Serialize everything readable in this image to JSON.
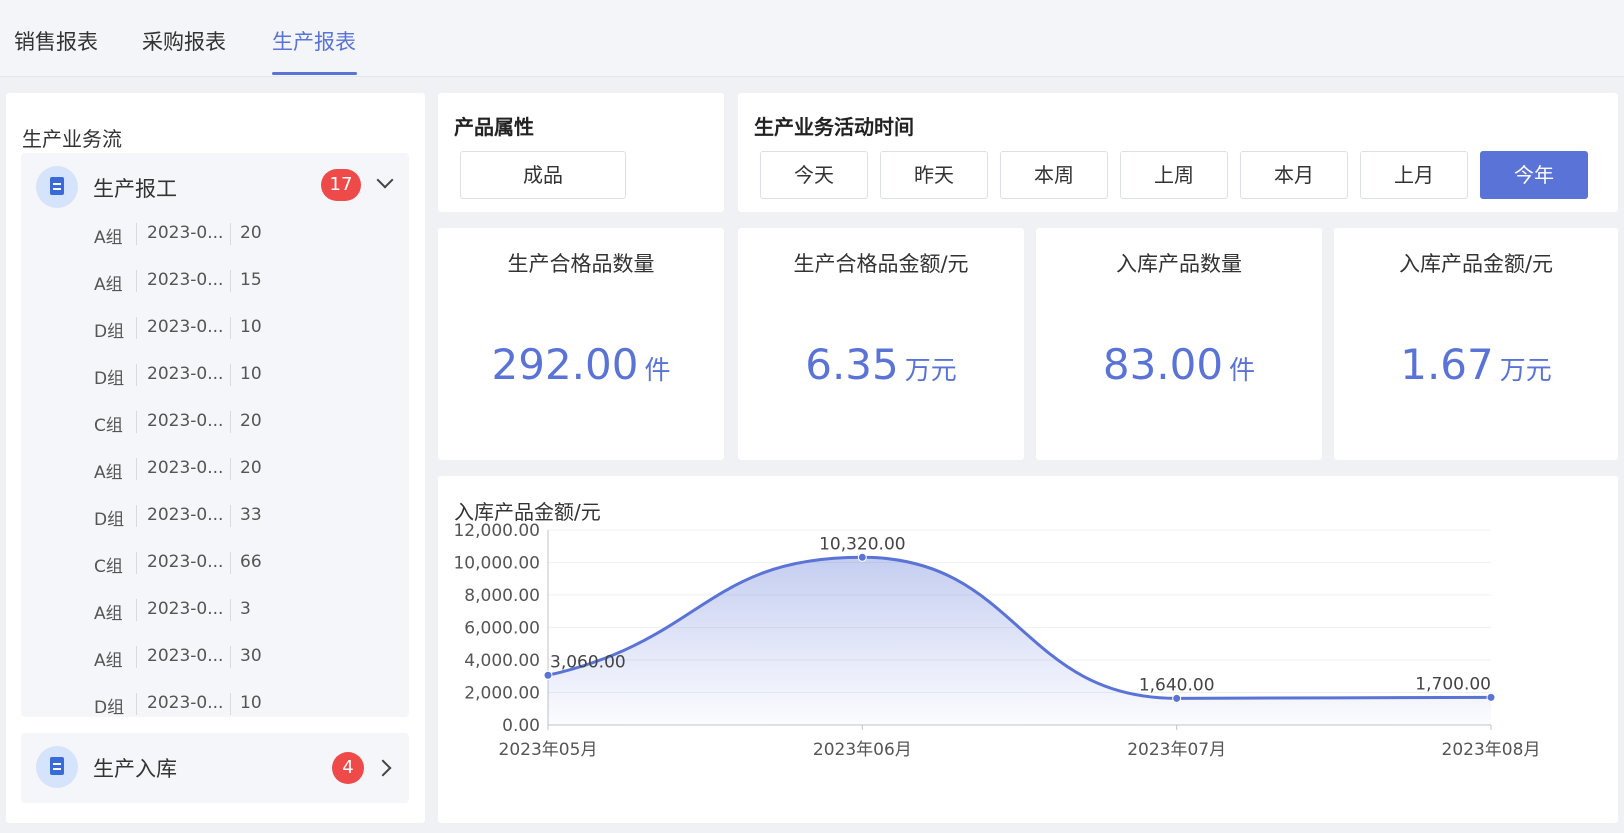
{
  "tabs": [
    {
      "label": "销售报表",
      "active": false
    },
    {
      "label": "采购报表",
      "active": false
    },
    {
      "label": "生产报表",
      "active": true
    }
  ],
  "flow": {
    "title": "生产业务流",
    "groups": [
      {
        "label": "生产报工",
        "count": "17",
        "expanded": true,
        "icon": "document-icon",
        "rows": [
          {
            "team": "A组",
            "date": "2023-0...",
            "qty": "20"
          },
          {
            "team": "A组",
            "date": "2023-0...",
            "qty": "15"
          },
          {
            "team": "D组",
            "date": "2023-0...",
            "qty": "10"
          },
          {
            "team": "D组",
            "date": "2023-0...",
            "qty": "10"
          },
          {
            "team": "C组",
            "date": "2023-0...",
            "qty": "20"
          },
          {
            "team": "A组",
            "date": "2023-0...",
            "qty": "20"
          },
          {
            "team": "D组",
            "date": "2023-0...",
            "qty": "33"
          },
          {
            "team": "C组",
            "date": "2023-0...",
            "qty": "66"
          },
          {
            "team": "A组",
            "date": "2023-0...",
            "qty": "3"
          },
          {
            "team": "A组",
            "date": "2023-0...",
            "qty": "30"
          },
          {
            "team": "D组",
            "date": "2023-0...",
            "qty": "10"
          }
        ]
      },
      {
        "label": "生产入库",
        "count": "4",
        "expanded": false,
        "icon": "document-icon"
      }
    ]
  },
  "product_attr": {
    "title": "产品属性",
    "value": "成品"
  },
  "activity_time": {
    "title": "生产业务活动时间",
    "options": [
      "今天",
      "昨天",
      "本周",
      "上周",
      "本月",
      "上月",
      "今年"
    ],
    "selected": "今年"
  },
  "stats": [
    {
      "label": "生产合格品数量",
      "value": "292.00",
      "unit": "件"
    },
    {
      "label": "生产合格品金额/元",
      "value": "6.35",
      "unit": "万元"
    },
    {
      "label": "入库产品数量",
      "value": "83.00",
      "unit": "件"
    },
    {
      "label": "入库产品金额/元",
      "value": "1.67",
      "unit": "万元"
    }
  ],
  "colors": {
    "accent": "#5a73d6",
    "badge": "#ef4a4a",
    "icon": "#3a6ad9"
  },
  "chart_data": {
    "type": "area",
    "title": "入库产品金额/元",
    "categories": [
      "2023年05月",
      "2023年06月",
      "2023年07月",
      "2023年08月"
    ],
    "values": [
      3060,
      10320,
      1640,
      1700
    ],
    "value_labels": [
      "3,060.00",
      "10,320.00",
      "1,640.00",
      "1,700.00"
    ],
    "yticks": [
      "0.00",
      "2,000.00",
      "4,000.00",
      "6,000.00",
      "8,000.00",
      "10,000.00",
      "12,000.00"
    ],
    "ylim": [
      0,
      12000
    ],
    "grid": true,
    "smooth": true
  }
}
